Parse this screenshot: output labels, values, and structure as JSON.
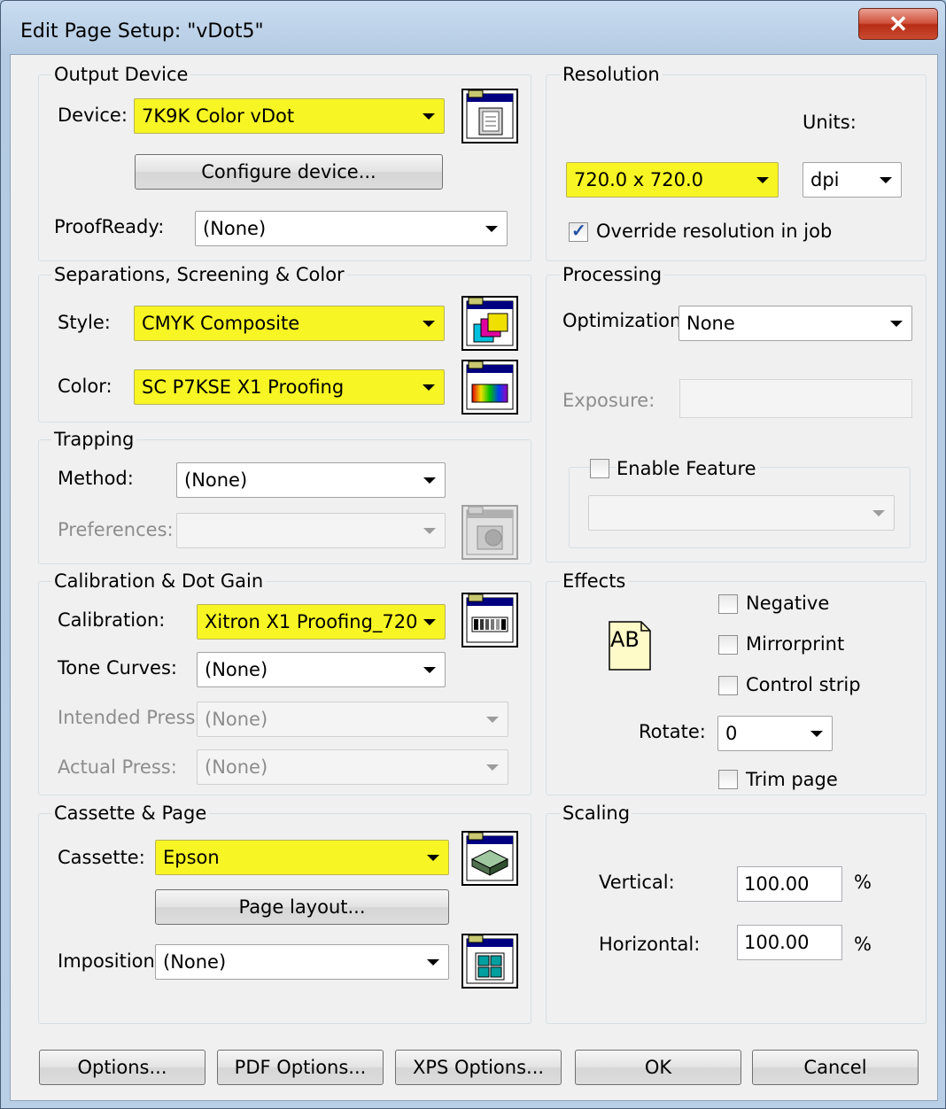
{
  "window": {
    "title": "Edit Page Setup: \"vDot5\"",
    "close_glyph": "✕"
  },
  "output_device": {
    "title": "Output Device",
    "device_label": "Device:",
    "device_value": "7K9K Color vDot",
    "configure_button": "Configure device...",
    "proofready_label": "ProofReady:",
    "proofready_value": "(None)"
  },
  "resolution": {
    "title": "Resolution",
    "units_label": "Units:",
    "value": "720.0 x 720.0",
    "units_value": "dpi",
    "override_label": "Override resolution in job",
    "override_checked": true
  },
  "separations": {
    "title": "Separations, Screening & Color",
    "style_label": "Style:",
    "style_value": "CMYK Composite",
    "color_label": "Color:",
    "color_value": "SC P7KSE X1 Proofing"
  },
  "processing": {
    "title": "Processing",
    "optimization_label": "Optimization:",
    "optimization_value": "None",
    "exposure_label": "Exposure:",
    "enable_feature_label": "Enable Feature",
    "enable_feature_checked": false
  },
  "trapping": {
    "title": "Trapping",
    "method_label": "Method:",
    "method_value": "(None)",
    "preferences_label": "Preferences:"
  },
  "calibration": {
    "title": "Calibration & Dot Gain",
    "calibration_label": "Calibration:",
    "calibration_value": "Xitron X1 Proofing_720",
    "tone_label": "Tone Curves:",
    "tone_value": "(None)",
    "intended_label": "Intended Press:",
    "intended_value": "(None)",
    "actual_label": "Actual Press:",
    "actual_value": "(None)"
  },
  "effects": {
    "title": "Effects",
    "preview_text": "AB",
    "negative_label": "Negative",
    "mirrorprint_label": "Mirrorprint",
    "control_strip_label": "Control strip",
    "rotate_label": "Rotate:",
    "rotate_value": "0",
    "trim_label": "Trim page"
  },
  "cassette": {
    "title": "Cassette & Page",
    "cassette_label": "Cassette:",
    "cassette_value": "Epson",
    "page_layout_button": "Page layout...",
    "imposition_label": "Imposition:",
    "imposition_value": "(None)"
  },
  "scaling": {
    "title": "Scaling",
    "vertical_label": "Vertical:",
    "vertical_value": "100.00",
    "vertical_unit": "%",
    "horizontal_label": "Horizontal:",
    "horizontal_value": "100.00",
    "horizontal_unit": "%"
  },
  "footer": {
    "options": "Options...",
    "pdf_options": "PDF Options...",
    "xps_options": "XPS Options...",
    "ok": "OK",
    "cancel": "Cancel"
  },
  "colors": {
    "highlight": "#f7f523",
    "title_bar": "#b9cfe6",
    "close": "#c94a30"
  },
  "icons": [
    "device-settings-icon",
    "style-settings-icon",
    "color-settings-icon",
    "trap-preferences-icon",
    "calibration-settings-icon",
    "cassette-settings-icon",
    "imposition-settings-icon"
  ]
}
